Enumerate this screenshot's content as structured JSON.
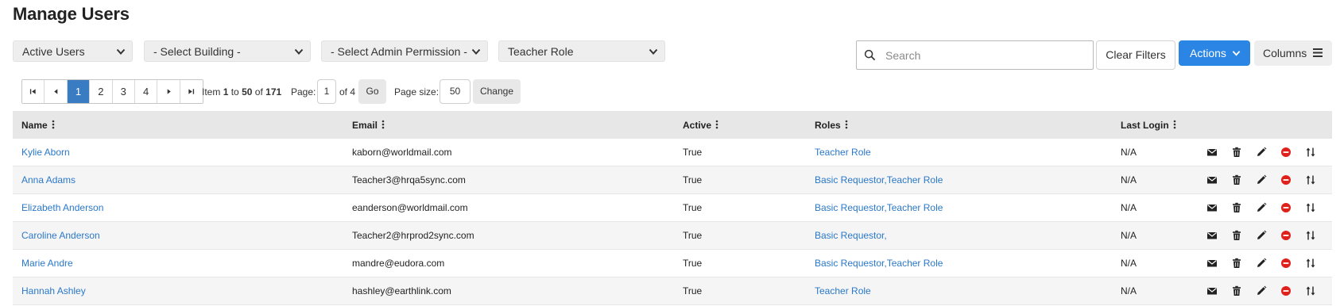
{
  "page": {
    "title": "Manage Users"
  },
  "filters": {
    "status": "Active Users",
    "building": "- Select Building -",
    "admin_permission": "- Select Admin Permission -",
    "role": "Teacher Role"
  },
  "toolbar": {
    "search_placeholder": "Search",
    "clear_filters": "Clear Filters",
    "actions": "Actions",
    "columns": "Columns"
  },
  "pager": {
    "pages": [
      "1",
      "2",
      "3",
      "4"
    ],
    "current_page": "1",
    "item_prefix": "Item",
    "item_from": "1",
    "item_to_word": "to",
    "item_to": "50",
    "item_of_word": "of",
    "item_total": "171",
    "page_label": "Page:",
    "page_value": "1",
    "of_pages": "of 4",
    "go": "Go",
    "page_size_label": "Page size:",
    "page_size_value": "50",
    "change": "Change"
  },
  "table": {
    "columns": [
      "Name",
      "Email",
      "Active",
      "Roles",
      "Last Login"
    ],
    "rows": [
      {
        "name": "Kylie Aborn",
        "email": "kaborn@worldmail.com",
        "active": "True",
        "roles": "Teacher Role",
        "last_login": "N/A"
      },
      {
        "name": "Anna Adams",
        "email": "Teacher3@hrqa5sync.com",
        "active": "True",
        "roles": "Basic Requestor,Teacher Role",
        "last_login": "N/A"
      },
      {
        "name": "Elizabeth Anderson",
        "email": "eanderson@worldmail.com",
        "active": "True",
        "roles": "Basic Requestor,Teacher Role",
        "last_login": "N/A"
      },
      {
        "name": "Caroline Anderson",
        "email": "Teacher2@hrprod2sync.com",
        "active": "True",
        "roles": "Basic Requestor,",
        "last_login": "N/A"
      },
      {
        "name": "Marie Andre",
        "email": "mandre@eudora.com",
        "active": "True",
        "roles": "Basic Requestor,Teacher Role",
        "last_login": "N/A"
      },
      {
        "name": "Hannah Ashley",
        "email": "hashley@earthlink.com",
        "active": "True",
        "roles": "Teacher Role",
        "last_login": "N/A"
      }
    ],
    "row_actions": [
      "envelope-icon",
      "trash-icon",
      "pencil-icon",
      "deactivate-icon",
      "sort-icon"
    ]
  },
  "colors": {
    "accent": "#2b85e4",
    "link": "#2a78c9",
    "active_page": "#3a7cc2",
    "danger": "#e0201b"
  }
}
